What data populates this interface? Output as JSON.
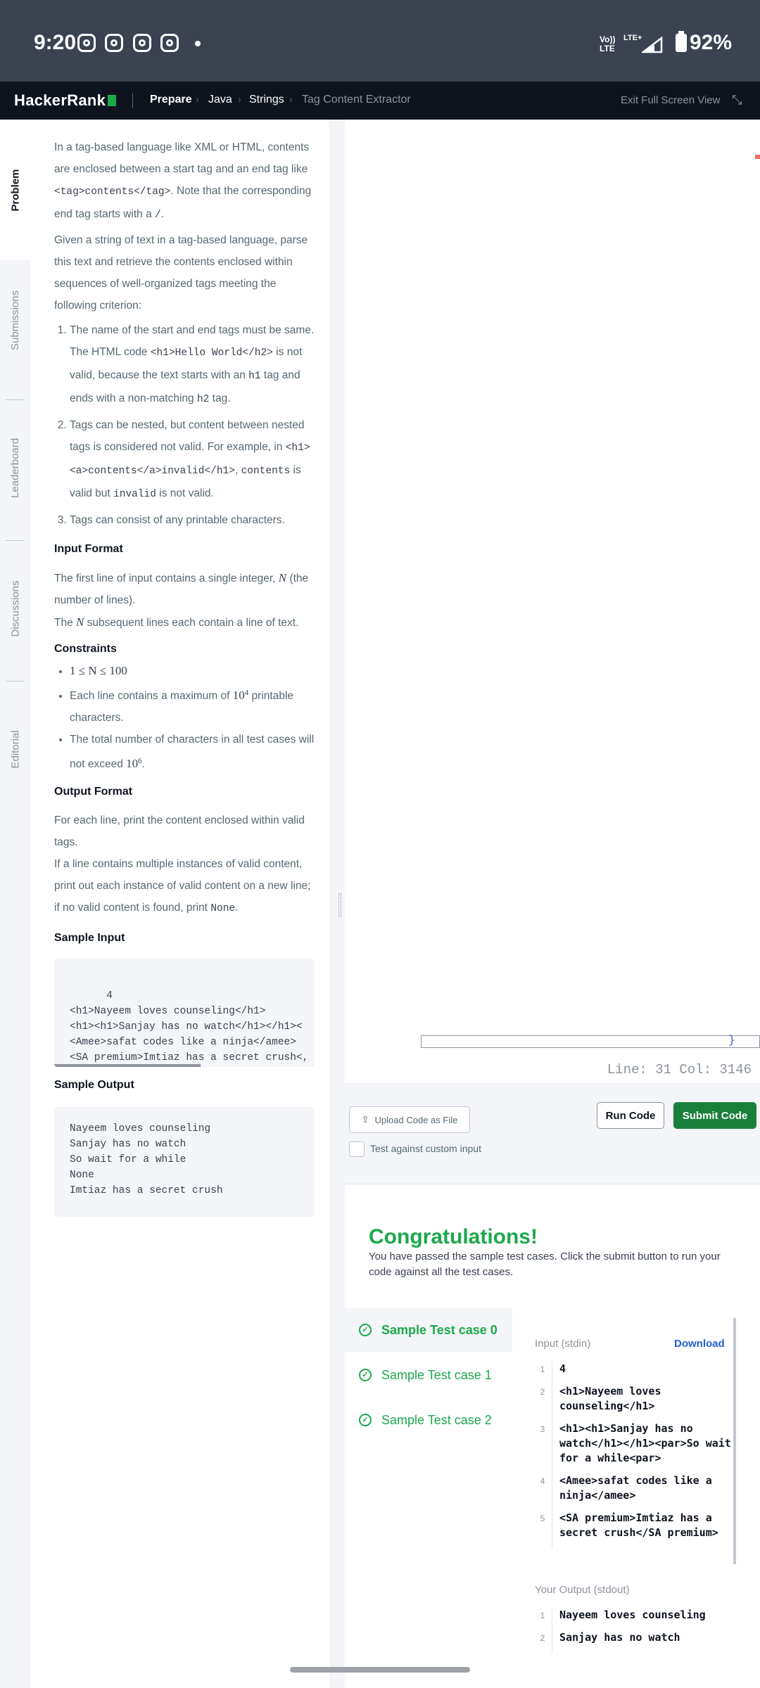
{
  "status_bar": {
    "time": "9:20",
    "network_top": "Vo))",
    "network_bottom": "LTE",
    "lte_label": "LTE+",
    "battery": "92%"
  },
  "header": {
    "logo": "HackerRank",
    "breadcrumbs": [
      "Prepare",
      "Java",
      "Strings",
      "Tag Content Extractor"
    ],
    "exit_label": "Exit Full Screen View"
  },
  "rail": {
    "tabs": [
      "Problem",
      "Submissions",
      "Leaderboard",
      "Discussions",
      "Editorial"
    ]
  },
  "problem": {
    "p1_a": "In a tag-based language like XML or HTML, contents are enclosed between a start tag and an end tag like ",
    "p1_code": "<tag>contents</tag>",
    "p1_b": ". Note that the corresponding end tag starts with a ",
    "p1_code2": "/",
    "p1_c": ".",
    "p2": "Given a string of text in a tag-based language, parse this text and retrieve the contents enclosed within sequences of well-organized tags meeting the following criterion:",
    "li1_a": "The name of the start and end tags must be same. The HTML code ",
    "li1_code": "<h1>Hello World</h2>",
    "li1_b": " is not valid, because the text starts with an ",
    "li1_code2": "h1",
    "li1_c": " tag and ends with a non-matching ",
    "li1_code3": "h2",
    "li1_d": " tag.",
    "li2_a": "Tags can be nested, but content between nested tags is considered not valid. For example, in ",
    "li2_code": "<h1><a>contents</a>invalid</h1>",
    "li2_b": ", ",
    "li2_code2": "contents",
    "li2_c": " is valid but ",
    "li2_code3": "invalid",
    "li2_d": " is not valid.",
    "li3": "Tags can consist of any printable characters.",
    "input_format_title": "Input Format",
    "if1_a": "The first line of input contains a single integer, ",
    "if1_var": "N",
    "if1_b": " (the number of lines).",
    "if2_a": "The ",
    "if2_var": "N",
    "if2_b": " subsequent lines each contain a line of text.",
    "constraints_title": "Constraints",
    "c1": "1 ≤ N ≤ 100",
    "c2_a": "Each line contains a maximum of ",
    "c2_math": "10",
    "c2_sup": "4",
    "c2_b": " printable characters.",
    "c3_a": "The total number of characters in all test cases will not exceed ",
    "c3_math": "10",
    "c3_sup": "6",
    "c3_b": ".",
    "output_format_title": "Output Format",
    "of1": "For each line, print the content enclosed within valid tags.",
    "of2_a": "If a line contains multiple instances of valid content, print out each instance of valid content on a new line; if no valid content is found, print ",
    "of2_code": "None",
    "of2_b": ".",
    "sample_input_title": "Sample Input",
    "sample_input": "4\n<h1>Nayeem loves counseling</h1>\n<h1><h1>Sanjay has no watch</h1></h1><\n<Amee>safat codes like a ninja</amee>\n<SA premium>Imtiaz has a secret crush<,",
    "sample_output_title": "Sample Output",
    "sample_output": "Nayeem loves counseling\nSanjay has no watch\nSo wait for a while\nNone\nImtiaz has a secret crush"
  },
  "editor": {
    "line_col": "Line: 31 Col: 3146",
    "brace": "}"
  },
  "actions": {
    "upload": "Upload Code as File",
    "run": "Run Code",
    "submit": "Submit Code",
    "custom_input": "Test against custom input"
  },
  "results": {
    "title": "Congratulations!",
    "subtitle": "You have passed the sample test cases. Click the submit button to run your code against all the test cases.",
    "test_cases": [
      "Sample Test case 0",
      "Sample Test case 1",
      "Sample Test case 2"
    ],
    "input_label": "Input (stdin)",
    "download": "Download",
    "input_lines": [
      {
        "n": "1",
        "t": "4"
      },
      {
        "n": "2",
        "t": "<h1>Nayeem loves counseling</h1>"
      },
      {
        "n": "3",
        "t": "<h1><h1>Sanjay has no watch</h1></h1><par>So wait for a while<par>"
      },
      {
        "n": "4",
        "t": "<Amee>safat codes like a ninja</amee>"
      },
      {
        "n": "5",
        "t": "<SA premium>Imtiaz has a secret crush</SA premium>"
      }
    ],
    "output_label": "Your Output (stdout)",
    "output_lines": [
      {
        "n": "1",
        "t": "Nayeem loves counseling"
      },
      {
        "n": "2",
        "t": "Sanjay has no watch"
      }
    ]
  }
}
